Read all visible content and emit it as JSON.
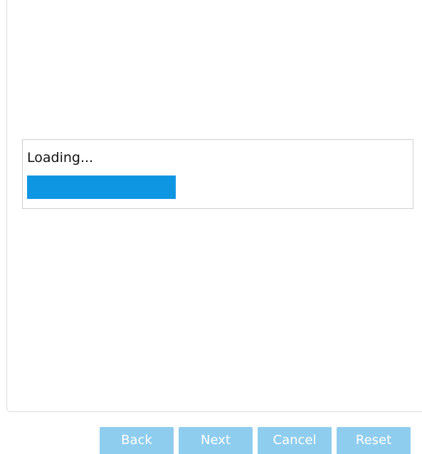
{
  "loading": {
    "text": "Loading...",
    "progress_percent": 39
  },
  "colors": {
    "progress_fill": "#0f96e3",
    "button_disabled_bg": "#8fcdee",
    "button_text": "#ffffff",
    "border": "#dcdcdc"
  },
  "buttons": {
    "back_label": "Back",
    "next_label": "Next",
    "cancel_label": "Cancel",
    "reset_label": "Reset"
  }
}
